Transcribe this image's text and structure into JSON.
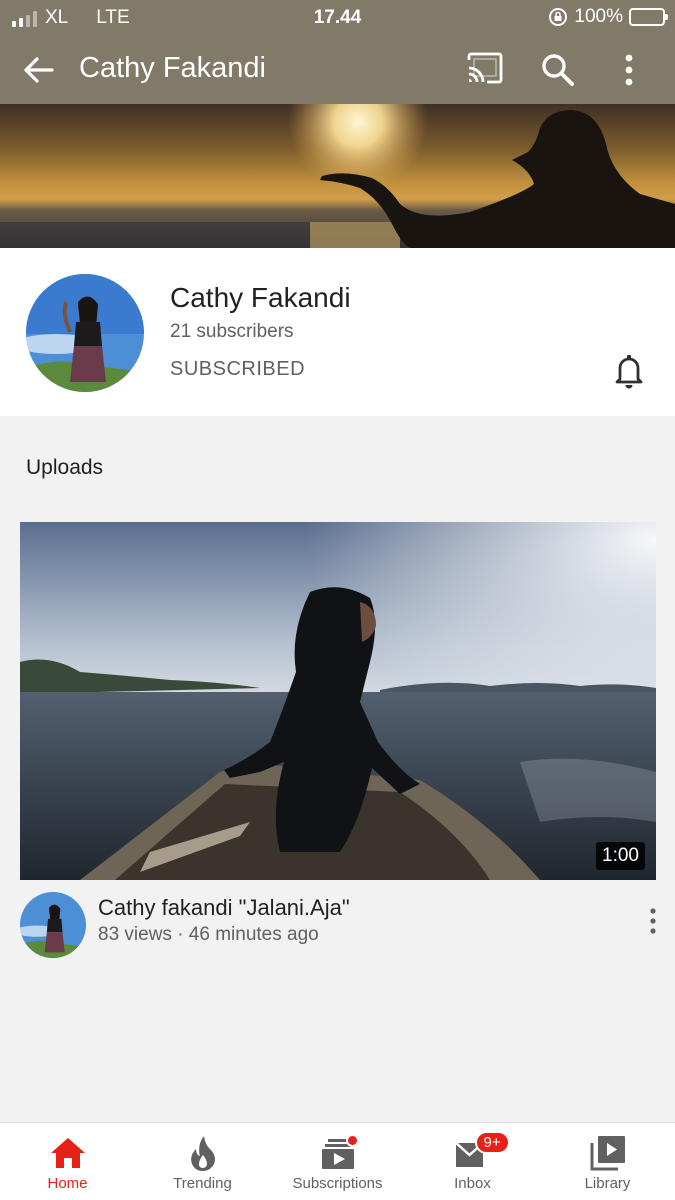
{
  "status_bar": {
    "carrier": "XL",
    "network": "LTE",
    "time": "17.44",
    "battery": "100%"
  },
  "app_bar": {
    "title": "Cathy Fakandi"
  },
  "channel": {
    "name": "Cathy Fakandi",
    "subscribers": "21 subscribers",
    "subscribe_state": "SUBSCRIBED"
  },
  "uploads": {
    "heading": "Uploads",
    "videos": [
      {
        "title": "Cathy fakandi \"Jalani.Aja\"",
        "meta": "83 views · 46 minutes ago",
        "duration": "1:00"
      }
    ]
  },
  "bottom_nav": {
    "items": [
      {
        "label": "Home",
        "icon": "home-icon",
        "active": true
      },
      {
        "label": "Trending",
        "icon": "trending-icon"
      },
      {
        "label": "Subscriptions",
        "icon": "subscriptions-icon"
      },
      {
        "label": "Inbox",
        "icon": "inbox-icon",
        "badge": "9+"
      },
      {
        "label": "Library",
        "icon": "library-icon"
      }
    ]
  },
  "colors": {
    "appbar": "#827a69",
    "accent": "#e62117",
    "battery": "#ffd21e"
  }
}
